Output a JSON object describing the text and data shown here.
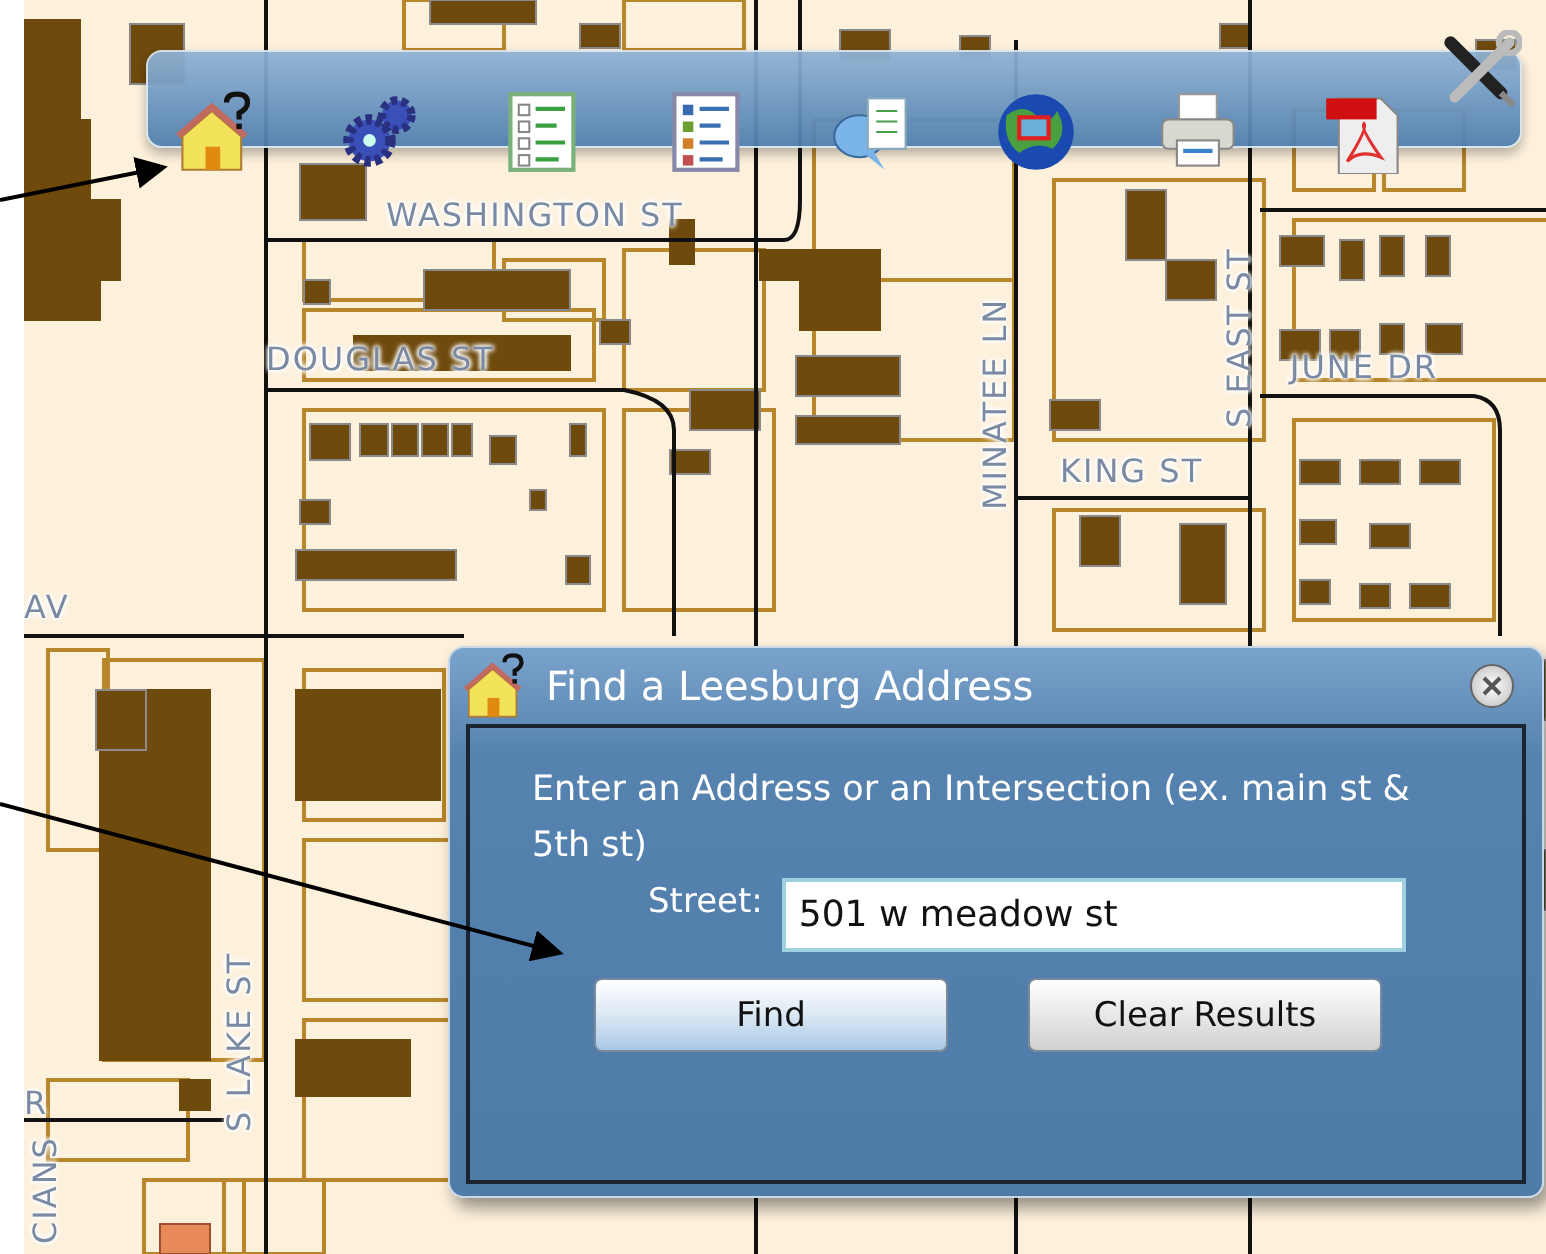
{
  "map": {
    "street_labels": [
      {
        "text": "WASHINGTON ST",
        "kind": "horizontal"
      },
      {
        "text": "DOUGLAS ST",
        "kind": "horizontal"
      },
      {
        "text": "AV",
        "kind": "horizontal"
      },
      {
        "text": "MINATEE LN",
        "kind": "vertical"
      },
      {
        "text": "KING ST",
        "kind": "horizontal"
      },
      {
        "text": "S EAST ST",
        "kind": "vertical"
      },
      {
        "text": "JUNE DR",
        "kind": "horizontal"
      },
      {
        "text": "S LAKE ST",
        "kind": "vertical"
      },
      {
        "text": "R",
        "kind": "horizontal"
      },
      {
        "text": "CIANS",
        "kind": "vertical"
      }
    ]
  },
  "dialog": {
    "title": "Find a Leesburg Address",
    "instructions": "Enter an Address or an Intersection (ex. main st & 5th st)",
    "street_label": "Street:",
    "street_value": "501 w meadow st",
    "buttons": [
      {
        "label": "Find",
        "focused": true
      },
      {
        "label": "Clear Results",
        "focused": false
      }
    ]
  }
}
